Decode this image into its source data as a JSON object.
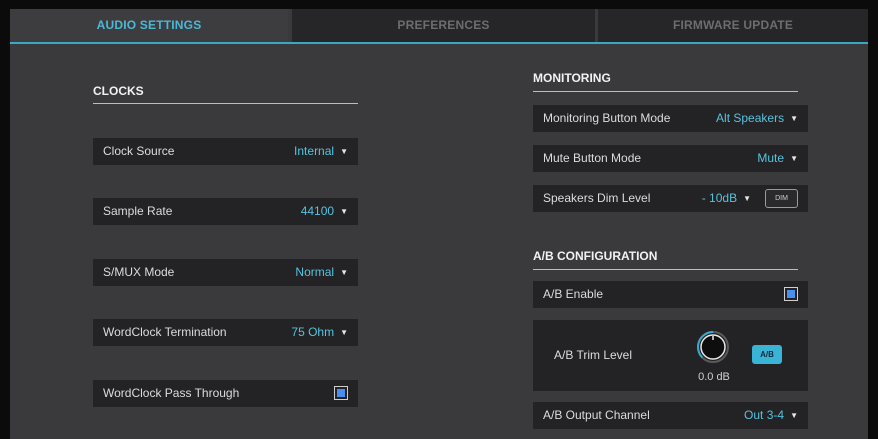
{
  "tabs": {
    "audio_settings": "AUDIO SETTINGS",
    "preferences": "PREFERENCES",
    "firmware_update": "FIRMWARE UPDATE"
  },
  "clocks": {
    "title": "CLOCKS",
    "clock_source": {
      "label": "Clock Source",
      "value": "Internal"
    },
    "sample_rate": {
      "label": "Sample Rate",
      "value": "44100"
    },
    "smux_mode": {
      "label": "S/MUX Mode",
      "value": "Normal"
    },
    "wordclock_termination": {
      "label": "WordClock Termination",
      "value": "75 Ohm"
    },
    "wordclock_pass_through": {
      "label": "WordClock Pass Through",
      "checked": true
    }
  },
  "monitoring": {
    "title": "MONITORING",
    "monitoring_button_mode": {
      "label": "Monitoring Button Mode",
      "value": "Alt Speakers"
    },
    "mute_button_mode": {
      "label": "Mute Button Mode",
      "value": "Mute"
    },
    "speakers_dim_level": {
      "label": "Speakers Dim Level",
      "value": "- 10dB",
      "dim_button": "DIM"
    }
  },
  "ab_configuration": {
    "title": "A/B CONFIGURATION",
    "ab_enable": {
      "label": "A/B Enable",
      "checked": true
    },
    "ab_trim_level": {
      "label": "A/B Trim Level",
      "value": "0.0 dB",
      "button": "A/B"
    },
    "ab_output_channel": {
      "label": "A/B Output Channel",
      "value": "Out 3-4"
    }
  },
  "icons": {
    "caret": "caret-down-icon",
    "checkbox": "checkbox-icon",
    "knob": "knob-icon"
  },
  "colors": {
    "accent": "#39a7c8",
    "value_text": "#55c3df",
    "checkbox_fill": "#4a8ff0",
    "ab_button": "#3ab4d6"
  }
}
